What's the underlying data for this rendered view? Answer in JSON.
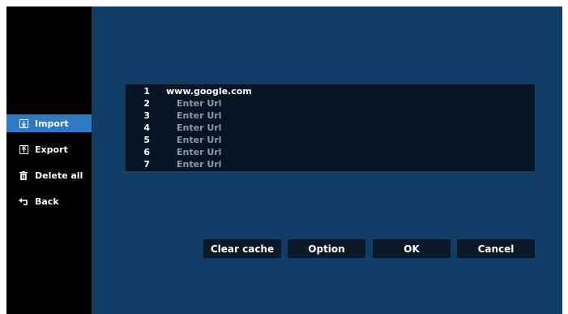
{
  "sidebar": {
    "items": [
      {
        "label": "Import",
        "icon": "import-icon",
        "active": true
      },
      {
        "label": "Export",
        "icon": "export-icon",
        "active": false
      },
      {
        "label": "Delete all",
        "icon": "trash-icon",
        "active": false
      },
      {
        "label": "Back",
        "icon": "back-arrow-icon",
        "active": false
      }
    ]
  },
  "url_list": {
    "rows": [
      {
        "num": "1",
        "value": "www.google.com",
        "placeholder": ""
      },
      {
        "num": "2",
        "value": "",
        "placeholder": "Enter Url"
      },
      {
        "num": "3",
        "value": "",
        "placeholder": "Enter Url"
      },
      {
        "num": "4",
        "value": "",
        "placeholder": "Enter Url"
      },
      {
        "num": "5",
        "value": "",
        "placeholder": "Enter Url"
      },
      {
        "num": "6",
        "value": "",
        "placeholder": "Enter Url"
      },
      {
        "num": "7",
        "value": "",
        "placeholder": "Enter Url"
      }
    ]
  },
  "buttons": {
    "clear_cache": "Clear cache",
    "option": "Option",
    "ok": "OK",
    "cancel": "Cancel"
  },
  "colors": {
    "sidebar_bg": "#000000",
    "main_bg": "#123d66",
    "active_item": "#2e79c4",
    "list_bg": "#061523",
    "button_bg": "#0a1a2a",
    "placeholder_text": "#8e99a4"
  }
}
